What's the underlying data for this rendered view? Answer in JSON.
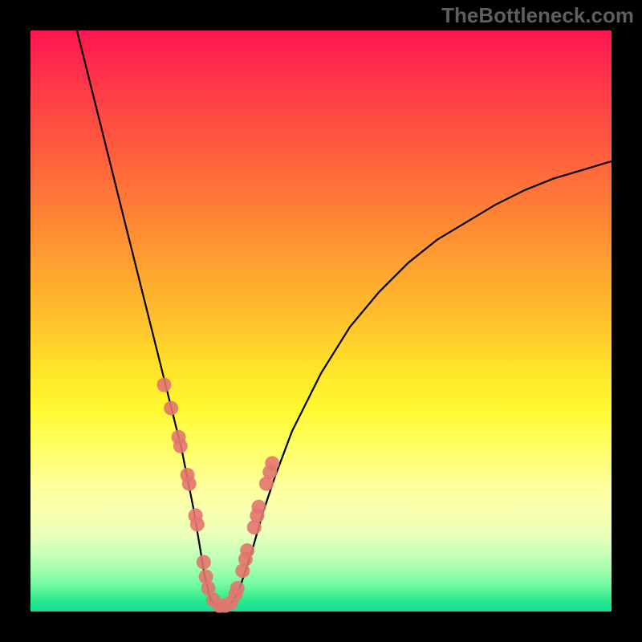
{
  "watermark": "TheBottleneck.com",
  "colors": {
    "bg": "#000000",
    "marker": "#e2766e",
    "curve": "#000000",
    "gradient_top": "#ff1551",
    "gradient_bottom": "#14df9a"
  },
  "chart_data": {
    "type": "line",
    "title": "",
    "xlabel": "",
    "ylabel": "",
    "xlim": [
      0,
      100
    ],
    "ylim": [
      0,
      100
    ],
    "note": "Axes have no tick labels; x is an implicit 0–100 horizontal index, y is 0 at bottom to 100 at top (percent-style bottleneck score). Values are read off pixel positions.",
    "series": [
      {
        "name": "curve",
        "x": [
          8.0,
          10,
          12,
          14,
          16,
          18,
          20,
          22,
          24,
          26,
          28,
          29,
          30,
          31,
          32,
          33,
          34,
          35,
          36,
          38,
          40,
          42,
          45,
          50,
          55,
          60,
          65,
          70,
          75,
          80,
          85,
          90,
          95,
          100
        ],
        "y": [
          100,
          92,
          84,
          76,
          68,
          60,
          52,
          44,
          36,
          28,
          18,
          12,
          6,
          2,
          1,
          1,
          1,
          2,
          4,
          10,
          17,
          23,
          31,
          41,
          49,
          55,
          60,
          64,
          67,
          70,
          72.5,
          74.5,
          76,
          77.5
        ]
      }
    ],
    "markers": {
      "name": "dots",
      "x": [
        23.0,
        24.2,
        25.5,
        25.8,
        27.0,
        27.3,
        28.4,
        28.7,
        29.8,
        30.2,
        30.6,
        31.5,
        32.5,
        33.5,
        34.5,
        35.3,
        35.6,
        36.5,
        37.0,
        37.3,
        38.5,
        39.0,
        39.3,
        40.6,
        41.2,
        41.6
      ],
      "y": [
        39.0,
        35.0,
        30.0,
        28.5,
        23.5,
        22.0,
        16.5,
        15.0,
        8.5,
        6.0,
        4.0,
        2.0,
        1.0,
        1.0,
        1.5,
        3.0,
        4.0,
        7.0,
        9.0,
        10.5,
        14.5,
        16.5,
        18.0,
        22.0,
        24.0,
        25.5
      ]
    }
  }
}
